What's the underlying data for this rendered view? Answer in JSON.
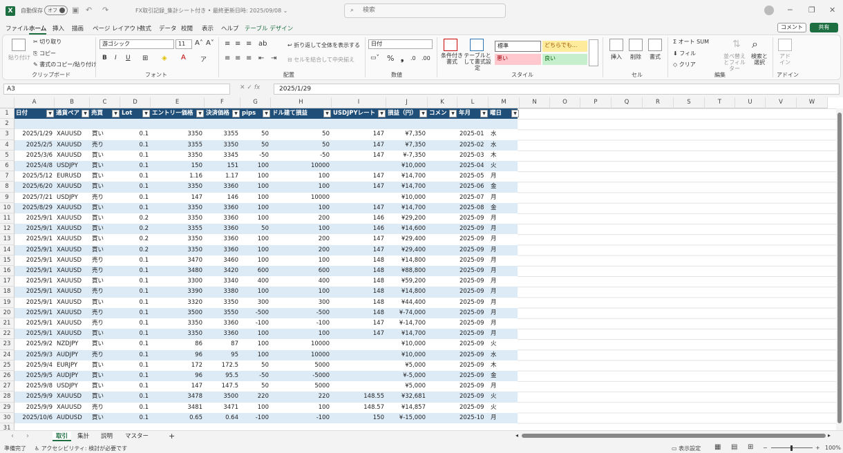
{
  "title": {
    "autosave": "自動保存",
    "toggle": "オフ",
    "doc": "FX取引記録_集計シート付き • 最終更新日時: 2025/09/08 ⌄",
    "search": "検索"
  },
  "menu": [
    "ファイル",
    "ホーム",
    "挿入",
    "描画",
    "ページ レイアウト",
    "数式",
    "データ",
    "校閲",
    "表示",
    "ヘルプ",
    "テーブル デザイン"
  ],
  "menu_right": {
    "comment": "コメント",
    "share": "共有"
  },
  "ribbon": {
    "paste": "貼り付け",
    "cut": "切り取り",
    "copy": "コピー",
    "format_painter": "書式のコピー/貼り付け",
    "clipboard": "クリップボード",
    "font_name": "游ゴシック",
    "font_size": "11",
    "font": "フォント",
    "wrap": "折り返して全体を表示する",
    "merge": "セルを結合して中央揃え",
    "align": "配置",
    "number_format": "日付",
    "number": "数値",
    "cond": "条件付き書式",
    "table_fmt": "テーブルとして書式設定",
    "style_normal": "標準",
    "style_neutral": "どちらでも...",
    "style_bad": "悪い",
    "style_good": "良い",
    "style": "スタイル",
    "insert": "挿入",
    "delete": "削除",
    "format": "書式",
    "cells": "セル",
    "autosum": "オート SUM",
    "fill": "フィル",
    "clear": "クリア",
    "sort": "並べ替えとフィルター",
    "find": "検索と選択",
    "edit": "編集",
    "addin": "アドイン",
    "addin_label": "アドイン"
  },
  "formula": {
    "cell": "A3",
    "value": "2025/1/29"
  },
  "columns": [
    "A",
    "B",
    "C",
    "D",
    "E",
    "F",
    "G",
    "H",
    "I",
    "J",
    "K",
    "L",
    "M",
    "N",
    "O",
    "P",
    "Q",
    "R",
    "S",
    "T",
    "U",
    "V",
    "W"
  ],
  "headers": [
    "日付",
    "通貨ペア",
    "売買",
    "Lot",
    "エントリー価格",
    "決済価格",
    "pips",
    "ドル建て損益",
    "USDJPYレート",
    "損益（円）",
    "コメント",
    "年月",
    "曜日"
  ],
  "rows": [
    [
      "2025/1/29",
      "XAUUSD",
      "買い",
      "0.1",
      "3350",
      "3355",
      "50",
      "50",
      "147",
      "¥7,350",
      "",
      "2025-01",
      "水"
    ],
    [
      "2025/2/5",
      "XAUUSD",
      "売り",
      "0.1",
      "3355",
      "3350",
      "50",
      "50",
      "147",
      "¥7,350",
      "",
      "2025-02",
      "水"
    ],
    [
      "2025/3/6",
      "XAUUSD",
      "買い",
      "0.1",
      "3350",
      "3345",
      "-50",
      "-50",
      "147",
      "¥-7,350",
      "",
      "2025-03",
      "木"
    ],
    [
      "2025/4/8",
      "USDJPY",
      "買い",
      "0.1",
      "150",
      "151",
      "100",
      "10000",
      "",
      "¥10,000",
      "",
      "2025-04",
      "火"
    ],
    [
      "2025/5/12",
      "EURUSD",
      "買い",
      "0.1",
      "1.16",
      "1.17",
      "100",
      "100",
      "147",
      "¥14,700",
      "",
      "2025-05",
      "月"
    ],
    [
      "2025/6/20",
      "XAUUSD",
      "買い",
      "0.1",
      "3350",
      "3360",
      "100",
      "100",
      "147",
      "¥14,700",
      "",
      "2025-06",
      "金"
    ],
    [
      "2025/7/21",
      "USDJPY",
      "売り",
      "0.1",
      "147",
      "146",
      "100",
      "10000",
      "",
      "¥10,000",
      "",
      "2025-07",
      "月"
    ],
    [
      "2025/8/29",
      "XAUUSD",
      "買い",
      "0.1",
      "3350",
      "3360",
      "100",
      "100",
      "147",
      "¥14,700",
      "",
      "2025-08",
      "金"
    ],
    [
      "2025/9/1",
      "XAUUSD",
      "買い",
      "0.2",
      "3350",
      "3360",
      "100",
      "200",
      "146",
      "¥29,200",
      "",
      "2025-09",
      "月"
    ],
    [
      "2025/9/1",
      "XAUUSD",
      "買い",
      "0.2",
      "3355",
      "3360",
      "50",
      "100",
      "146",
      "¥14,600",
      "",
      "2025-09",
      "月"
    ],
    [
      "2025/9/1",
      "XAUUSD",
      "買い",
      "0.2",
      "3350",
      "3360",
      "100",
      "200",
      "147",
      "¥29,400",
      "",
      "2025-09",
      "月"
    ],
    [
      "2025/9/1",
      "XAUUSD",
      "買い",
      "0.2",
      "3350",
      "3360",
      "100",
      "200",
      "147",
      "¥29,400",
      "",
      "2025-09",
      "月"
    ],
    [
      "2025/9/1",
      "XAUUSD",
      "売り",
      "0.1",
      "3470",
      "3460",
      "100",
      "100",
      "148",
      "¥14,800",
      "",
      "2025-09",
      "月"
    ],
    [
      "2025/9/1",
      "XAUUSD",
      "売り",
      "0.1",
      "3480",
      "3420",
      "600",
      "600",
      "148",
      "¥88,800",
      "",
      "2025-09",
      "月"
    ],
    [
      "2025/9/1",
      "XAUUSD",
      "買い",
      "0.1",
      "3300",
      "3340",
      "400",
      "400",
      "148",
      "¥59,200",
      "",
      "2025-09",
      "月"
    ],
    [
      "2025/9/1",
      "XAUUSD",
      "売り",
      "0.1",
      "3390",
      "3380",
      "100",
      "100",
      "148",
      "¥14,800",
      "",
      "2025-09",
      "月"
    ],
    [
      "2025/9/1",
      "XAUUSD",
      "買い",
      "0.1",
      "3320",
      "3350",
      "300",
      "300",
      "148",
      "¥44,400",
      "",
      "2025-09",
      "月"
    ],
    [
      "2025/9/1",
      "XAUUSD",
      "売り",
      "0.1",
      "3500",
      "3550",
      "-500",
      "-500",
      "148",
      "¥-74,000",
      "",
      "2025-09",
      "月"
    ],
    [
      "2025/9/1",
      "XAUUSD",
      "売り",
      "0.1",
      "3350",
      "3360",
      "-100",
      "-100",
      "147",
      "¥-14,700",
      "",
      "2025-09",
      "月"
    ],
    [
      "2025/9/1",
      "XAUUSD",
      "買い",
      "0.1",
      "3350",
      "3360",
      "100",
      "100",
      "147",
      "¥14,700",
      "",
      "2025-09",
      "月"
    ],
    [
      "2025/9/2",
      "NZDJPY",
      "買い",
      "0.1",
      "86",
      "87",
      "100",
      "10000",
      "",
      "¥10,000",
      "",
      "2025-09",
      "火"
    ],
    [
      "2025/9/3",
      "AUDJPY",
      "売り",
      "0.1",
      "96",
      "95",
      "100",
      "10000",
      "",
      "¥10,000",
      "",
      "2025-09",
      "水"
    ],
    [
      "2025/9/4",
      "EURJPY",
      "買い",
      "0.1",
      "172",
      "172.5",
      "50",
      "5000",
      "",
      "¥5,000",
      "",
      "2025-09",
      "木"
    ],
    [
      "2025/9/5",
      "AUDJPY",
      "買い",
      "0.1",
      "96",
      "95.5",
      "-50",
      "-5000",
      "",
      "¥-5,000",
      "",
      "2025-09",
      "金"
    ],
    [
      "2025/9/8",
      "USDJPY",
      "買い",
      "0.1",
      "147",
      "147.5",
      "50",
      "5000",
      "",
      "¥5,000",
      "",
      "2025-09",
      "月"
    ],
    [
      "2025/9/9",
      "XAUUSD",
      "買い",
      "0.1",
      "3478",
      "3500",
      "220",
      "220",
      "148.55",
      "¥32,681",
      "",
      "2025-09",
      "火"
    ],
    [
      "2025/9/9",
      "XAUUSD",
      "売り",
      "0.1",
      "3481",
      "3471",
      "100",
      "100",
      "148.57",
      "¥14,857",
      "",
      "2025-09",
      "火"
    ],
    [
      "2025/10/6",
      "AUDUSD",
      "買い",
      "0.1",
      "0.65",
      "0.64",
      "-100",
      "-100",
      "150",
      "¥-15,000",
      "",
      "2025-10",
      "月"
    ]
  ],
  "sheets": [
    "取引",
    "集計",
    "説明",
    "マスター"
  ],
  "status": {
    "ready": "準備完了",
    "access": "アクセシビリティ: 検討が必要です",
    "display": "表示設定",
    "zoom": "100%"
  }
}
